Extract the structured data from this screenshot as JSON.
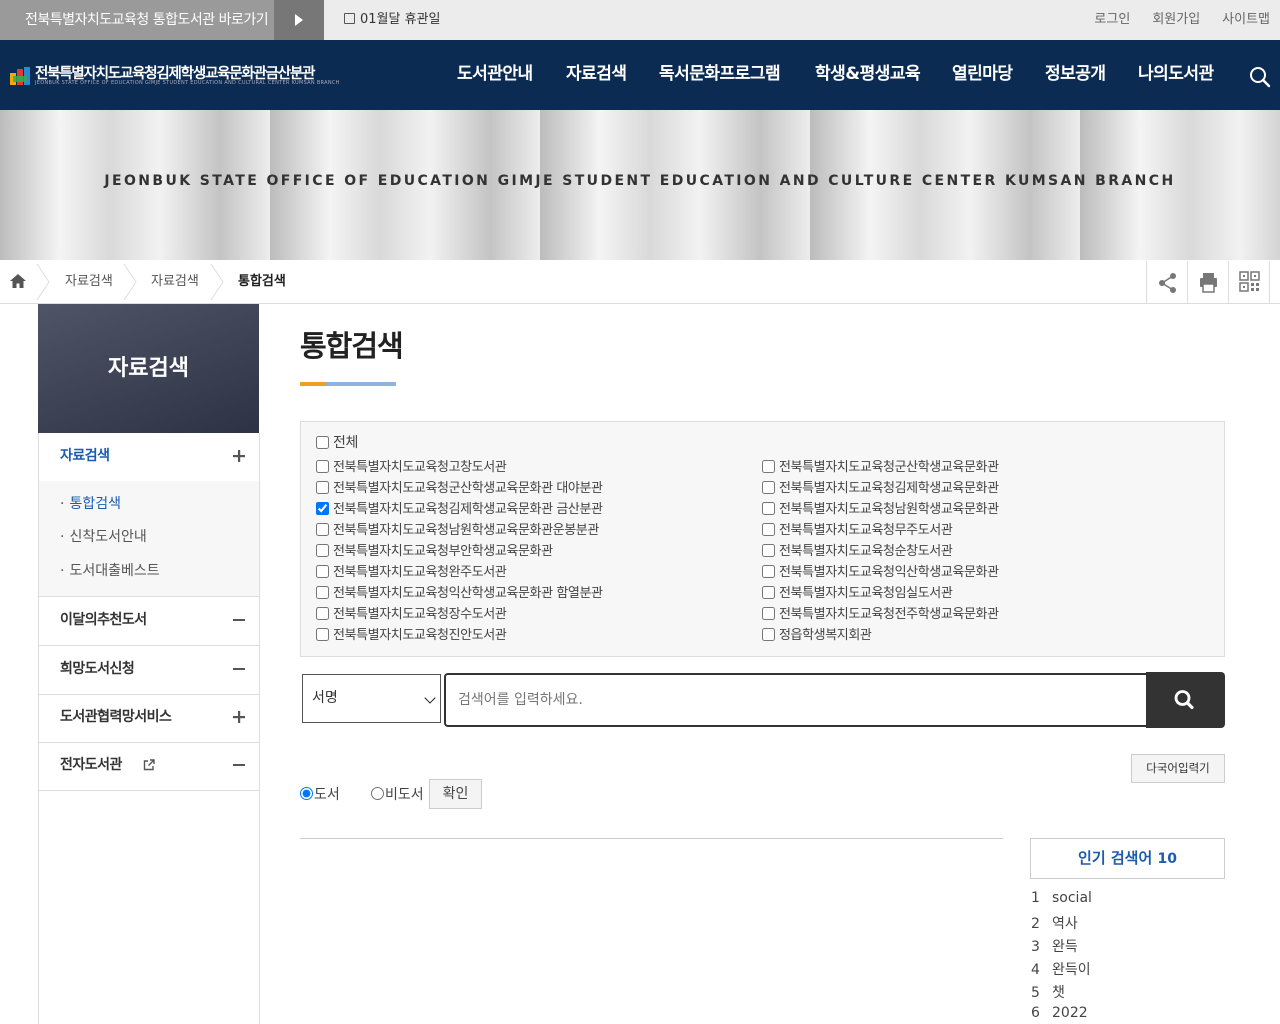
{
  "topbar": {
    "portal_link": "전북특별자치도교육청 통합도서관 바로가기",
    "closed_days": "01월달 휴관일",
    "util": [
      "로그인",
      "회원가입",
      "사이트맵"
    ]
  },
  "header": {
    "logo_title": "전북특별자치도교육청김제학생교육문화관금산분관",
    "logo_subtitle": "JEONBUK STATE OFFICE OF EDUCATION GIMJE STUDENT EDUCATION AND CULTURAL CENTER KUMSAN BRANCH",
    "menu": [
      "도서관안내",
      "자료검색",
      "독서문화프로그램",
      "학생&평생교육",
      "열린마당",
      "정보공개",
      "나의도서관"
    ]
  },
  "banner": {
    "text": "JEONBUK STATE OFFICE OF EDUCATION GIMJE STUDENT EDUCATION AND CULTURE CENTER KUMSAN BRANCH"
  },
  "breadcrumb": [
    "자료검색",
    "자료검색",
    "통합검색"
  ],
  "sidebar": {
    "title": "자료검색",
    "items": [
      {
        "label": "자료검색",
        "sign": "+",
        "active": true
      },
      {
        "label": "이달의추천도서",
        "sign": "−"
      },
      {
        "label": "희망도서신청",
        "sign": "−"
      },
      {
        "label": "도서관협력망서비스",
        "sign": "+"
      },
      {
        "label": "전자도서관",
        "sign": "−"
      }
    ],
    "subitems": [
      "통합검색",
      "신착도서안내",
      "도서대출베스트"
    ]
  },
  "page": {
    "title": "통합검색"
  },
  "libraries": {
    "all_label": "전체",
    "left": [
      {
        "label": "전북특별자치도교육청고창도서관",
        "checked": false
      },
      {
        "label": "전북특별자치도교육청군산학생교육문화관 대야분관",
        "checked": false
      },
      {
        "label": "전북특별자치도교육청김제학생교육문화관 금산분관",
        "checked": true
      },
      {
        "label": "전북특별자치도교육청남원학생교육문화관운봉분관",
        "checked": false
      },
      {
        "label": "전북특별자치도교육청부안학생교육문화관",
        "checked": false
      },
      {
        "label": "전북특별자치도교육청완주도서관",
        "checked": false
      },
      {
        "label": "전북특별자치도교육청익산학생교육문화관 함열분관",
        "checked": false
      },
      {
        "label": "전북특별자치도교육청장수도서관",
        "checked": false
      },
      {
        "label": "전북특별자치도교육청진안도서관",
        "checked": false
      }
    ],
    "right": [
      {
        "label": "전북특별자치도교육청군산학생교육문화관",
        "checked": false
      },
      {
        "label": "전북특별자치도교육청김제학생교육문화관",
        "checked": false
      },
      {
        "label": "전북특별자치도교육청남원학생교육문화관",
        "checked": false
      },
      {
        "label": "전북특별자치도교육청무주도서관",
        "checked": false
      },
      {
        "label": "전북특별자치도교육청순창도서관",
        "checked": false
      },
      {
        "label": "전북특별자치도교육청익산학생교육문화관",
        "checked": false
      },
      {
        "label": "전북특별자치도교육청임실도서관",
        "checked": false
      },
      {
        "label": "전북특별자치도교육청전주학생교육문화관",
        "checked": false
      },
      {
        "label": "정읍학생복지회관",
        "checked": false
      }
    ]
  },
  "search": {
    "field_value": "서명",
    "placeholder": "검색어를 입력하세요.",
    "multilang_button": "다국어입력기",
    "radio_book": "도서",
    "radio_nonbook": "비도서",
    "confirm_button": "확인"
  },
  "popular": {
    "heading": "인기 검색어",
    "count": "10",
    "items": [
      "social",
      "역사",
      "완득",
      "완득이",
      "챗",
      "2022"
    ]
  }
}
